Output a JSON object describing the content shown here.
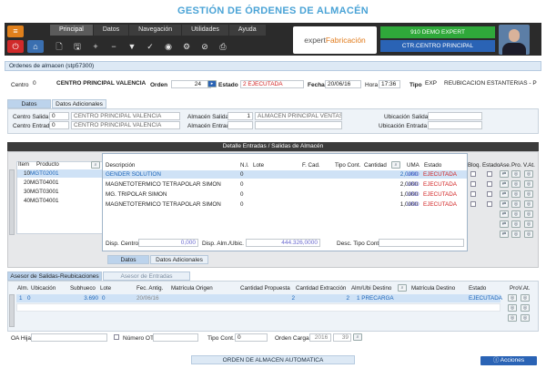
{
  "page_title": "GESTIÓN DE ÓRDENES DE ALMACÉN",
  "menu": [
    "Principal",
    "Datos",
    "Navegación",
    "Utilidades",
    "Ayuda"
  ],
  "logo": {
    "part1": "expert",
    "part2": "Fabricación"
  },
  "user": {
    "company": "910 DEMO EXPERT",
    "center": "CTR.CENTRO PRINCIPAL"
  },
  "window_title": "Ordenes de almacen (stp57300)",
  "header": {
    "centro_label": "Centro",
    "centro_code": "0",
    "centro_name": "CENTRO PRINCIPAL VALENCIA",
    "orden_label": "Orden",
    "orden_value": "24",
    "estado_label": "Estado",
    "estado_value": "2 EJECUTADA",
    "fecha_label": "Fecha",
    "fecha_value": "20/06/16",
    "hora_label": "Hora",
    "hora_value": "17:36",
    "tipo_label": "Tipo",
    "tipo_code": "EXP",
    "tipo_name": "REUBICACION ESTANTERIAS - PR"
  },
  "tabs1": [
    "Datos",
    "Datos Adicionales"
  ],
  "datos": {
    "cs_label": "Centro Salida",
    "cs_code": "0",
    "cs_name": "CENTRO PRINCIPAL VALENCIA",
    "ce_label": "Centro Entrada",
    "ce_code": "0",
    "ce_name": "CENTRO PRINCIPAL VALENCIA",
    "as_label": "Almacén Salida",
    "as_code": "1",
    "as_name": "ALMACEN PRINCIPAL VENTAS",
    "ae_label": "Almacén Entrada",
    "us_label": "Ubicación Salida",
    "ue_label": "Ubicación Entrada"
  },
  "detalle_title": "Detalle Entradas / Salidas de Almacén",
  "items_headers": {
    "item": "Item",
    "producto": "Producto"
  },
  "items": [
    {
      "item": "10",
      "producto": "MGT02001"
    },
    {
      "item": "20",
      "producto": "MGT04001"
    },
    {
      "item": "30",
      "producto": "MGT03001"
    },
    {
      "item": "40",
      "producto": "MGT04001"
    }
  ],
  "lines_headers": {
    "descripcion": "Descripción",
    "nl": "N.I.",
    "lote": "Lote",
    "fcad": "F. Cad.",
    "tipo_cont": "Tipo Cont.",
    "cantidad": "Cantidad",
    "uma": "UMA",
    "estado": "Estado"
  },
  "lines": [
    {
      "descripcion": "GENDER SOLUTION",
      "nl": "0",
      "cantidad": "2,0000",
      "uma": "UND",
      "estado": "EJECUTADA"
    },
    {
      "descripcion": "MAGNETOTERMICO TETRAPOLAR SIMON",
      "nl": "0",
      "cantidad": "2,0000",
      "uma": "UND",
      "estado": "EJECUTADA"
    },
    {
      "descripcion": "MG. TRIPOLAR SIMON",
      "nl": "0",
      "cantidad": "1,0000",
      "uma": "UND",
      "estado": "EJECUTADA"
    },
    {
      "descripcion": "MAGNETOTERMICO TETRAPOLAR SIMON",
      "nl": "0",
      "cantidad": "1,0000",
      "uma": "UND",
      "estado": "EJECUTADA"
    }
  ],
  "right_headers": {
    "bloq": "Bloq.",
    "estado": "Estado",
    "ase": "Ase.",
    "pro": "Pro.",
    "vat": "V.At."
  },
  "lines_footer": {
    "disp_centro_label": "Disp. Centro",
    "disp_centro": "0,000",
    "disp_alm_label": "Disp. Alm./Ubic.",
    "disp_alm": "444.326,0000",
    "desc_tipo_label": "Desc. Tipo Cont."
  },
  "tabs2": [
    "Datos",
    "Datos Adicionales"
  ],
  "tabs3": [
    "Asesor de Salidas-Reubicaciones",
    "Asesor de Entradas"
  ],
  "asesor_headers": {
    "alm": "Alm.",
    "ubicacion": "Ubicación",
    "subhueco": "Subhueco",
    "lote": "Lote",
    "fec_antig": "Fec. Antig.",
    "matricula_origen": "Matrícula Origen",
    "cantidad_propuesta": "Cantidad Propuesta",
    "cantidad_extraccion": "Cantidad Extracción",
    "alm_ubi_destino": "Alm/Ubi Destino",
    "matricula_destino": "Matrícula Destino",
    "estado": "Estado",
    "prov_at": "ProV.At."
  },
  "asesor_row": {
    "alm": "1",
    "ubicacion": "0",
    "subhueco": "3.690",
    "lote": "0",
    "fec_antig": "20/06/16",
    "cantidad_propuesta": "2",
    "cantidad_extraccion": "2",
    "alm_ubi_destino": "1 PRECARGA",
    "estado": "EJECUTADA"
  },
  "bottom": {
    "oa_hija_label": "OA Hija",
    "numero_ot_label": "Número OT",
    "tipo_cont_label": "Tipo Cont.",
    "tipo_cont_value": "0",
    "orden_carga_label": "Orden Carga",
    "orden_carga_year": "2016",
    "orden_carga_num": "39"
  },
  "footer": "ORDEN DE ALMACEN AUTOMATICA",
  "acciones": "Acciones"
}
